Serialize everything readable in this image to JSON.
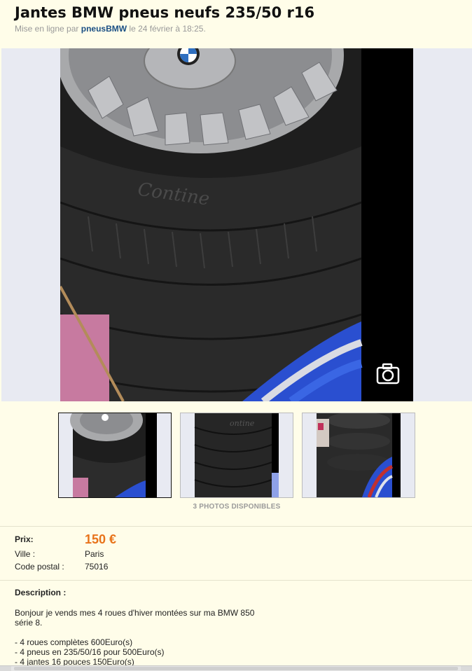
{
  "listing": {
    "title": "Jantes BMW pneus neufs 235/50 r16",
    "posted_prefix": "Mise en ligne par",
    "seller": "pneusBMW",
    "posted_suffix": "le 24 février à 18:25."
  },
  "gallery": {
    "photos_label": "3 PHOTOS DISPONIBLES"
  },
  "details": {
    "price_label": "Prix:",
    "price_value": "150 €",
    "city_label": "Ville :",
    "city_value": "Paris",
    "postal_label": "Code postal :",
    "postal_value": "75016"
  },
  "description": {
    "heading": "Description :",
    "line1": "Bonjour je vends mes 4 roues d'hiver montées sur ma BMW 850",
    "line2": "série 8.",
    "item1": "- 4 roues complètes 600Euro(s)",
    "item2": "- 4 pneus en 235/50/16 pour 500Euro(s)",
    "item3": "- 4 jantes 16 pouces 150Euro(s)"
  },
  "colors": {
    "page_background": "#fffde9",
    "price": "#e8731a",
    "seller_link": "#1a4f84"
  }
}
